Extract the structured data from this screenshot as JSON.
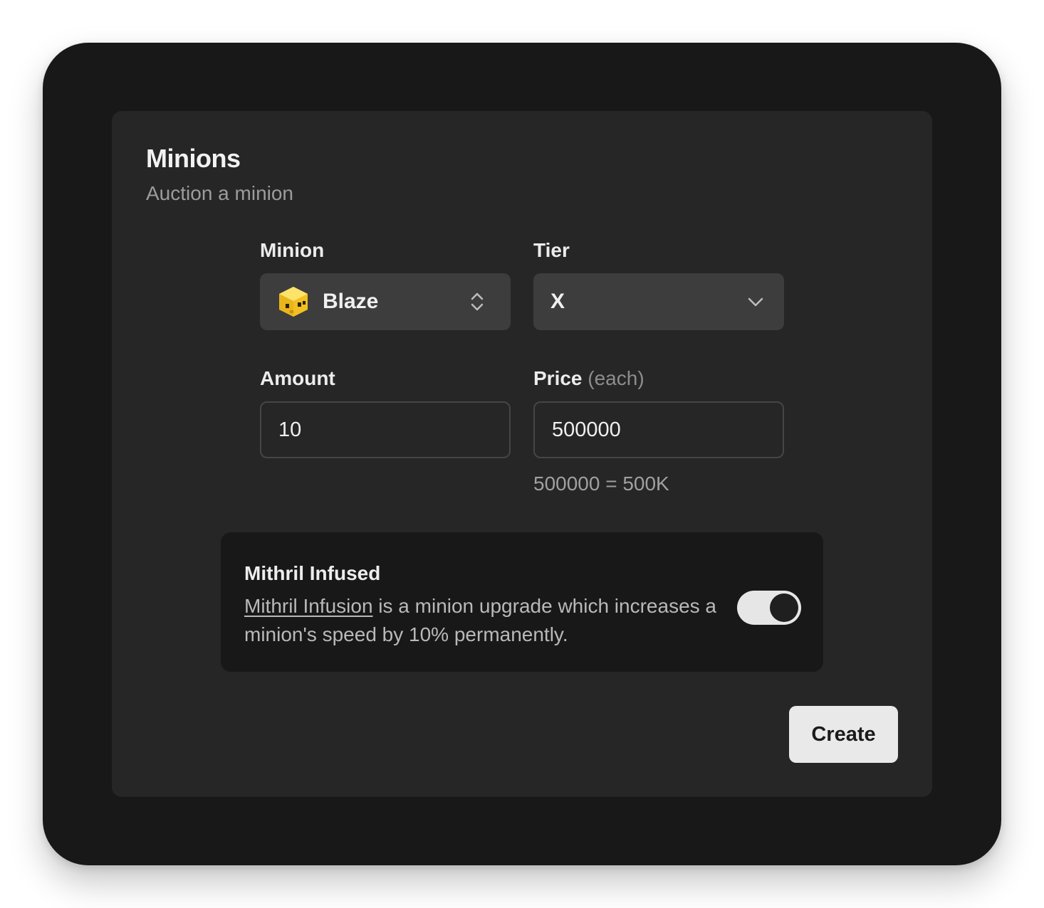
{
  "card": {
    "title": "Minions",
    "subtitle": "Auction a minion"
  },
  "fields": {
    "minion": {
      "label": "Minion",
      "value": "Blaze",
      "icon": "blaze-minion-icon"
    },
    "tier": {
      "label": "Tier",
      "value": "X",
      "icon": "chevron-down-icon"
    },
    "amount": {
      "label": "Amount",
      "value": "10"
    },
    "price": {
      "label": "Price",
      "label_suffix": "(each)",
      "value": "500000",
      "hint": "500000 = 500K"
    }
  },
  "mithril": {
    "title": "Mithril Infused",
    "link_text": "Mithril Infusion",
    "description": " is a minion upgrade which increases a minion's speed by 10% permanently.",
    "enabled": true
  },
  "actions": {
    "create_label": "Create"
  },
  "colors": {
    "window_bg": "#181818",
    "card_bg": "#262626",
    "select_bg": "#3d3d3d",
    "toggle_on": "#e6e6e6",
    "blaze_yellow": "#f5c518"
  }
}
